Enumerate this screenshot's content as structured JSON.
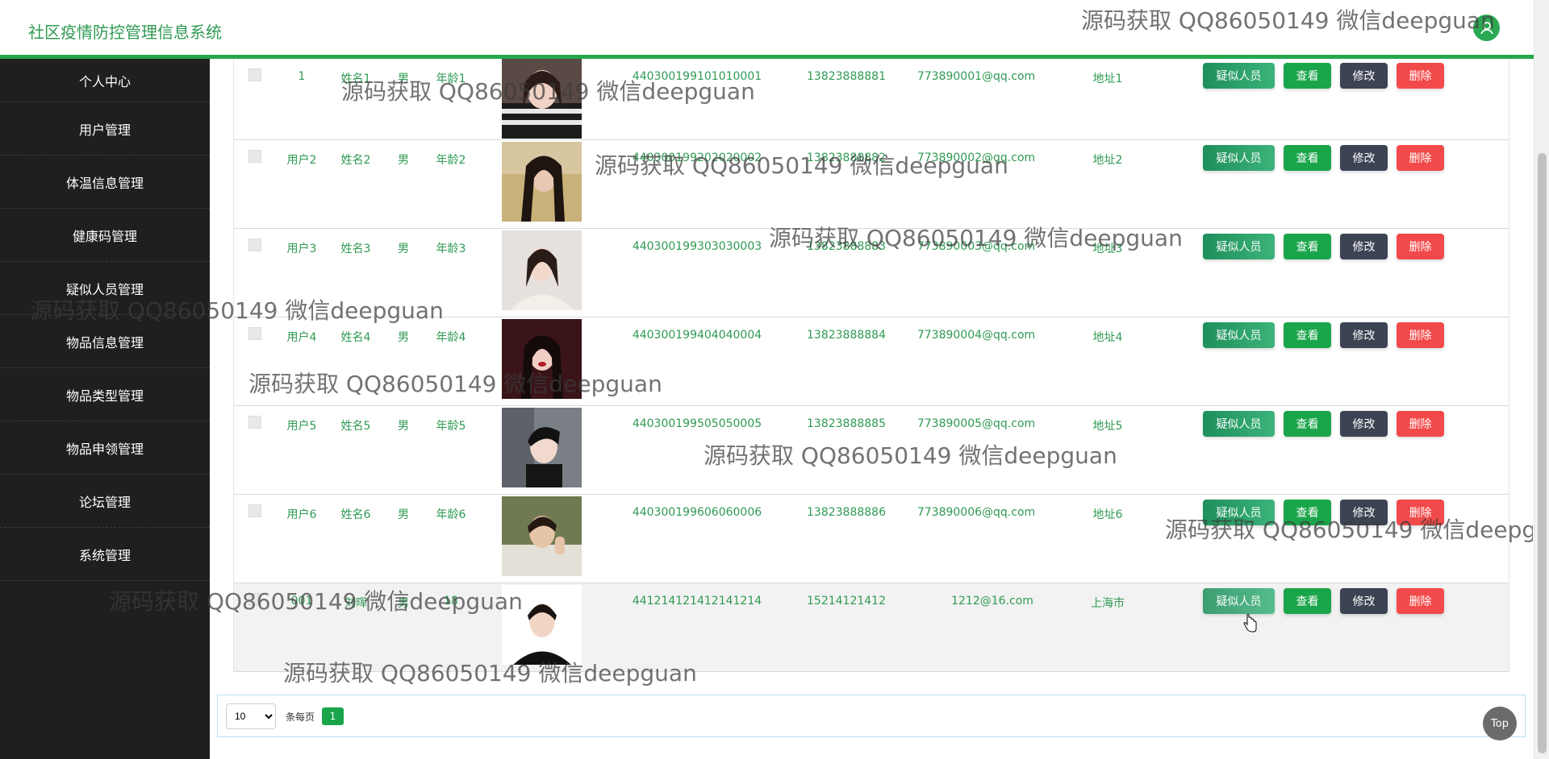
{
  "header": {
    "title": "社区疫情防控管理信息系统"
  },
  "sidebar": {
    "items": [
      {
        "label": "个人中心"
      },
      {
        "label": "用户管理"
      },
      {
        "label": "体温信息管理"
      },
      {
        "label": "健康码管理"
      },
      {
        "label": "疑似人员管理"
      },
      {
        "label": "物品信息管理"
      },
      {
        "label": "物品类型管理"
      },
      {
        "label": "物品申领管理"
      },
      {
        "label": "论坛管理"
      },
      {
        "label": "系统管理"
      }
    ]
  },
  "table": {
    "actions": {
      "suspect": "疑似人员",
      "view": "查看",
      "edit": "修改",
      "delete": "删除"
    },
    "rows": [
      {
        "account": "1",
        "name": "姓名1",
        "gender": "男",
        "age": "年龄1",
        "id_number": "440300199101010001",
        "phone": "13823888881",
        "email": "773890001@qq.com",
        "address": "地址1"
      },
      {
        "account": "用户2",
        "name": "姓名2",
        "gender": "男",
        "age": "年龄2",
        "id_number": "440300199202020002",
        "phone": "13823888882",
        "email": "773890002@qq.com",
        "address": "地址2"
      },
      {
        "account": "用户3",
        "name": "姓名3",
        "gender": "男",
        "age": "年龄3",
        "id_number": "440300199303030003",
        "phone": "13823888883",
        "email": "773890003@qq.com",
        "address": "地址3"
      },
      {
        "account": "用户4",
        "name": "姓名4",
        "gender": "男",
        "age": "年龄4",
        "id_number": "440300199404040004",
        "phone": "13823888884",
        "email": "773890004@qq.com",
        "address": "地址4"
      },
      {
        "account": "用户5",
        "name": "姓名5",
        "gender": "男",
        "age": "年龄5",
        "id_number": "440300199505050005",
        "phone": "13823888885",
        "email": "773890005@qq.com",
        "address": "地址5"
      },
      {
        "account": "用户6",
        "name": "姓名6",
        "gender": "男",
        "age": "年龄6",
        "id_number": "440300199606060006",
        "phone": "13823888886",
        "email": "773890006@qq.com",
        "address": "地址6"
      },
      {
        "account": "001",
        "name": "刘晖",
        "gender": "男",
        "age": "18",
        "id_number": "441214121412141214",
        "phone": "15214121412",
        "email": "1212@16.com",
        "address": "上海市"
      }
    ]
  },
  "pagination": {
    "page_size": "10",
    "per_page_label": "条每页",
    "current_page": "1"
  },
  "top_button": "Top",
  "watermark": "源码获取 QQ86050149 微信deepguan",
  "colors": {
    "accent": "#22a84a",
    "sidebar_bg": "#1f1f1f",
    "text_green": "#2f9a53",
    "delete": "#f24a4a",
    "edit": "#3c4353"
  }
}
